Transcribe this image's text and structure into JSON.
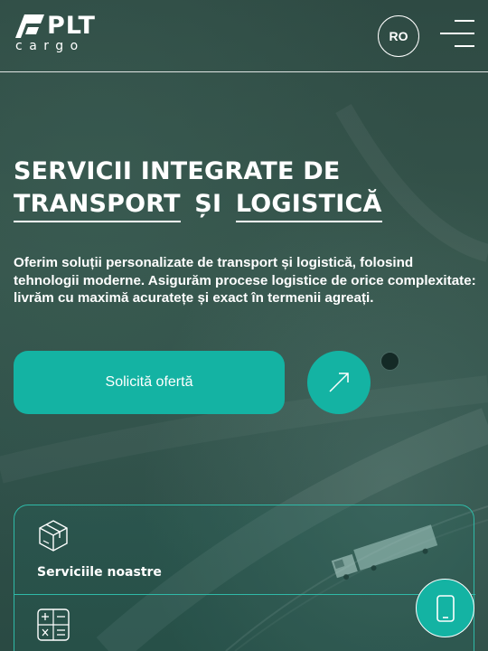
{
  "header": {
    "logo_main": "PLT",
    "logo_sub": "cargo",
    "lang_label": "RO",
    "menu_icon": "hamburger-menu-icon"
  },
  "hero": {
    "title_line1": "SERVICII INTEGRATE DE",
    "title_word1": "TRANSPORT",
    "title_connector": "ȘI",
    "title_word2": "LOGISTICĂ",
    "description": "Oferim soluții personalizate de transport și logistică, folosind tehnologii moderne. Asigurăm procese logistice de orice complexitate: livrăm cu maximă acuratețe și exact în termenii agreați.",
    "cta_label": "Solicită ofertă",
    "arrow_icon": "arrow-up-right-icon"
  },
  "services": {
    "items": [
      {
        "label": "Serviciile noastre",
        "icon": "box-icon"
      },
      {
        "label": "",
        "icon": "calculator-icon"
      }
    ]
  },
  "contact": {
    "icon": "phone-icon"
  },
  "colors": {
    "accent": "#14b3a3",
    "card_border": "#2fb9a7",
    "background": "#2c4a42",
    "text": "#ffffff"
  }
}
